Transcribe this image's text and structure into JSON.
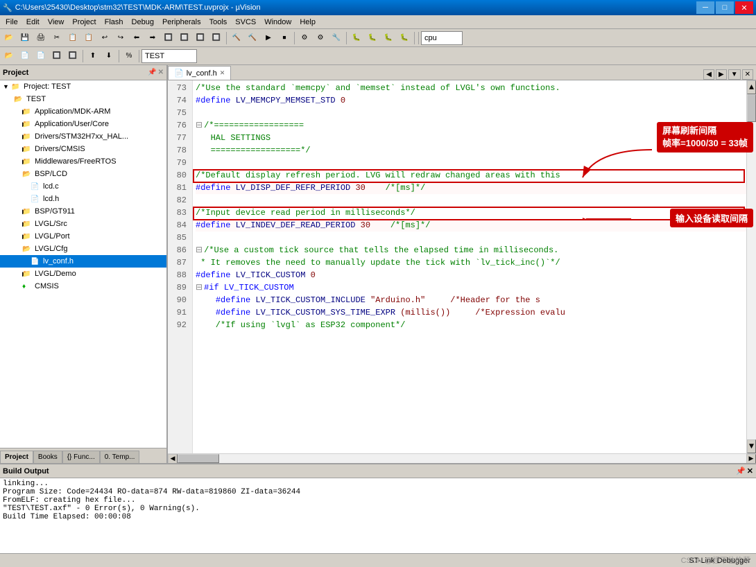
{
  "titleBar": {
    "title": "C:\\Users\\25430\\Desktop\\stm32\\TEST\\MDK-ARM\\TEST.uvprojx - µVision",
    "minBtn": "─",
    "maxBtn": "□",
    "closeBtn": "✕"
  },
  "menuBar": {
    "items": [
      "File",
      "Edit",
      "View",
      "Project",
      "Flash",
      "Debug",
      "Peripherals",
      "Tools",
      "SVCS",
      "Window",
      "Help"
    ]
  },
  "toolbar": {
    "cpuLabel": "cpu"
  },
  "toolbar2": {
    "projectLabel": "TEST"
  },
  "sidebar": {
    "title": "Project",
    "root": "Project: TEST",
    "tree": [
      {
        "label": "TEST",
        "level": 1,
        "type": "folder",
        "expanded": true
      },
      {
        "label": "Application/MDK-ARM",
        "level": 2,
        "type": "folder",
        "expanded": false
      },
      {
        "label": "Application/User/Core",
        "level": 2,
        "type": "folder",
        "expanded": false
      },
      {
        "label": "Drivers/STM32H7xx_HAL...",
        "level": 2,
        "type": "folder",
        "expanded": false
      },
      {
        "label": "Drivers/CMSIS",
        "level": 2,
        "type": "folder",
        "expanded": false
      },
      {
        "label": "Middlewares/FreeRTOS",
        "level": 2,
        "type": "folder",
        "expanded": false
      },
      {
        "label": "BSP/LCD",
        "level": 2,
        "type": "folder",
        "expanded": true
      },
      {
        "label": "lcd.c",
        "level": 3,
        "type": "file"
      },
      {
        "label": "lcd.h",
        "level": 3,
        "type": "file"
      },
      {
        "label": "BSP/GT911",
        "level": 2,
        "type": "folder",
        "expanded": false
      },
      {
        "label": "LVGL/Src",
        "level": 2,
        "type": "folder",
        "expanded": false
      },
      {
        "label": "LVGL/Port",
        "level": 2,
        "type": "folder",
        "expanded": false
      },
      {
        "label": "LVGL/Cfg",
        "level": 2,
        "type": "folder",
        "expanded": true
      },
      {
        "label": "lv_conf.h",
        "level": 3,
        "type": "file",
        "selected": true
      },
      {
        "label": "LVGL/Demo",
        "level": 2,
        "type": "folder",
        "expanded": false
      },
      {
        "label": "CMSIS",
        "level": 2,
        "type": "diamond"
      }
    ],
    "tabs": [
      "Project",
      "Books",
      "{} Func...",
      "0. Temp..."
    ]
  },
  "editor": {
    "activeTab": "lv_conf.h",
    "lines": [
      {
        "num": 73,
        "text": "/*Use the standard `memcpy` and `memset` instead of LVGL's own functions.",
        "type": "comment"
      },
      {
        "num": 74,
        "text": "#define LV_MEMCPY_MEMSET_STD 0",
        "type": "define"
      },
      {
        "num": 75,
        "text": "",
        "type": "normal"
      },
      {
        "num": 76,
        "text": "/*==================",
        "type": "comment",
        "hasExpand": true
      },
      {
        "num": 77,
        "text": "   HAL SETTINGS",
        "type": "comment"
      },
      {
        "num": 78,
        "text": "   ==================*/",
        "type": "comment"
      },
      {
        "num": 79,
        "text": "",
        "type": "normal"
      },
      {
        "num": 80,
        "text": "/*Default display refresh period. LVG will redraw changed areas with this",
        "type": "comment"
      },
      {
        "num": 81,
        "text": "#define LV_DISP_DEF_REFR_PERIOD 30    /*[ms]*/",
        "type": "define-red"
      },
      {
        "num": 82,
        "text": "",
        "type": "normal"
      },
      {
        "num": 83,
        "text": "/*Input device read period in milliseconds*/",
        "type": "comment"
      },
      {
        "num": 84,
        "text": "#define LV_INDEV_DEF_READ_PERIOD 30    /*[ms]*/",
        "type": "define-red"
      },
      {
        "num": 85,
        "text": "",
        "type": "normal"
      },
      {
        "num": 86,
        "text": "/*Use a custom tick source that tells the elapsed time in milliseconds.",
        "type": "comment",
        "hasExpand": true
      },
      {
        "num": 87,
        "text": " * It removes the need to manually update the tick with `lv_tick_inc()`*/",
        "type": "comment"
      },
      {
        "num": 88,
        "text": "#define LV_TICK_CUSTOM 0",
        "type": "define"
      },
      {
        "num": 89,
        "text": "#if LV_TICK_CUSTOM",
        "type": "preprocessor",
        "hasExpand": true
      },
      {
        "num": 90,
        "text": "    #define LV_TICK_CUSTOM_INCLUDE \"Arduino.h\"     /*Header for the s",
        "type": "define"
      },
      {
        "num": 91,
        "text": "    #define LV_TICK_CUSTOM_SYS_TIME_EXPR (millis())     /*Expression evalu",
        "type": "define"
      },
      {
        "num": 92,
        "text": "    /*If using `lvgl` as ESP32 component*/",
        "type": "comment"
      }
    ],
    "annotations": [
      {
        "id": "ann1",
        "text": "屏幕刷新间隔\n帧率=1000/30 = 33帧",
        "targetLine": 81
      },
      {
        "id": "ann2",
        "text": "输入设备读取间隔",
        "targetLine": 84
      }
    ]
  },
  "buildOutput": {
    "title": "Build Output",
    "lines": [
      "linking...",
      "Program Size: Code=24434 RO-data=874 RW-data=819860 ZI-data=36244",
      "FromELF: creating hex file...",
      "\"TEST\\TEST.axf\" - 0 Error(s), 0 Warning(s).",
      "Build Time Elapsed:  00:00:08"
    ]
  },
  "statusBar": {
    "left": "",
    "right": "ST-Link Debugger"
  },
  "watermark": "CSDN @捏不住的草"
}
